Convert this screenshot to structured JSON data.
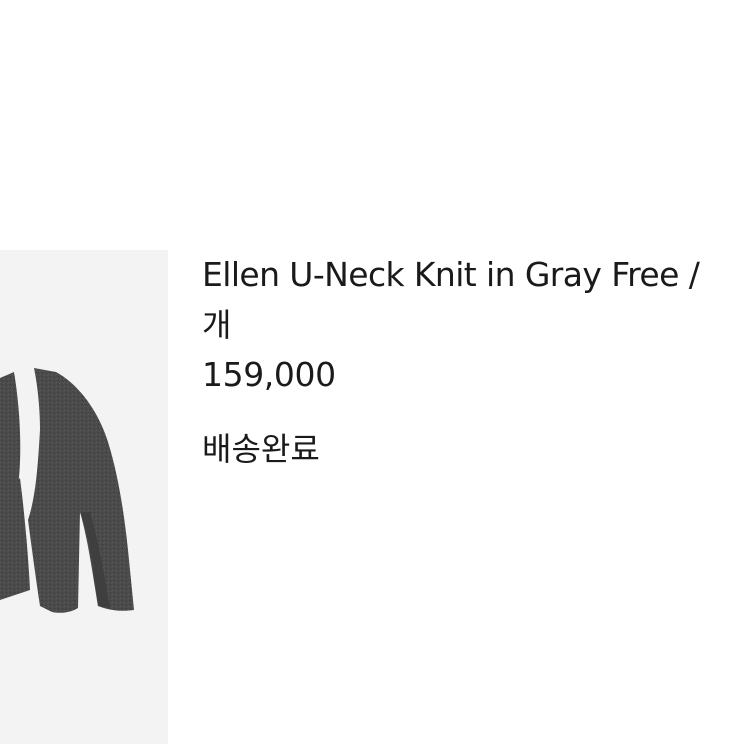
{
  "product": {
    "title": "Ellen U-Neck Knit in Gray Free /",
    "qty_unit": "개",
    "price": "159,000",
    "status": "배송완료",
    "image_icon": "gray-knit-sweater-image"
  },
  "colors": {
    "thumb_bg": "#f3f3f3",
    "sweater": "#4a4a4a",
    "text": "#1a1a1a"
  }
}
